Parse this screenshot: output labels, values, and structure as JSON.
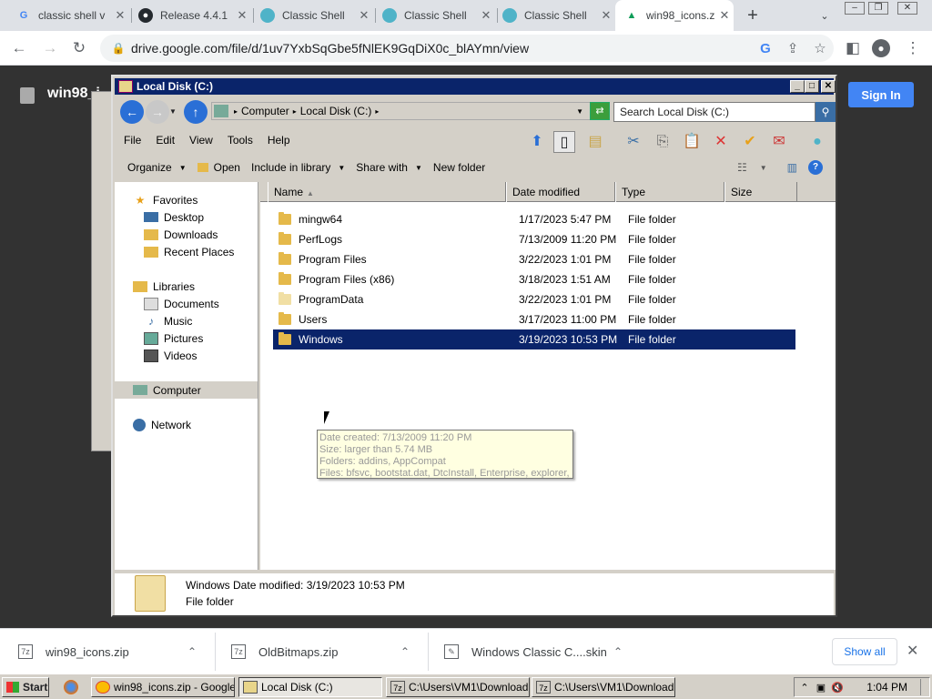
{
  "browser": {
    "tabs": [
      {
        "label": "classic shell v",
        "icon": "google-icon"
      },
      {
        "label": "Release 4.4.1",
        "icon": "github-icon"
      },
      {
        "label": "Classic Shell",
        "icon": "classic-shell-icon"
      },
      {
        "label": "Classic Shell",
        "icon": "classic-shell-icon"
      },
      {
        "label": "Classic Shell",
        "icon": "classic-shell-icon"
      },
      {
        "label": "win98_icons.z",
        "icon": "google-drive-icon",
        "active": true
      }
    ],
    "new_tab": "+",
    "url": "drive.google.com/file/d/1uv7YxbSqGbe5fNlEK9GqDiX0c_blAYmn/view"
  },
  "drive": {
    "file_title": "win98_i",
    "sign_in": "Sign In"
  },
  "explorer": {
    "title": "Local Disk (C:)",
    "address": [
      "Computer",
      "Local Disk (C:)"
    ],
    "search_placeholder": "Search Local Disk (C:)",
    "menu": [
      "File",
      "Edit",
      "View",
      "Tools",
      "Help"
    ],
    "commands": {
      "organize": "Organize",
      "open": "Open",
      "include": "Include in library",
      "share": "Share with",
      "new_folder": "New folder"
    },
    "nav": {
      "favorites": "Favorites",
      "desktop": "Desktop",
      "downloads": "Downloads",
      "recent": "Recent Places",
      "libraries": "Libraries",
      "documents": "Documents",
      "music": "Music",
      "pictures": "Pictures",
      "videos": "Videos",
      "computer": "Computer",
      "network": "Network"
    },
    "columns": {
      "name": "Name",
      "date": "Date modified",
      "type": "Type",
      "size": "Size"
    },
    "files": [
      {
        "name": "mingw64",
        "date": "1/17/2023 5:47 PM",
        "type": "File folder"
      },
      {
        "name": "PerfLogs",
        "date": "7/13/2009 11:20 PM",
        "type": "File folder"
      },
      {
        "name": "Program Files",
        "date": "3/22/2023 1:01 PM",
        "type": "File folder"
      },
      {
        "name": "Program Files (x86)",
        "date": "3/18/2023 1:51 AM",
        "type": "File folder"
      },
      {
        "name": "ProgramData",
        "date": "3/22/2023 1:01 PM",
        "type": "File folder"
      },
      {
        "name": "Users",
        "date": "3/17/2023 11:00 PM",
        "type": "File folder"
      },
      {
        "name": "Windows",
        "date": "3/19/2023 10:53 PM",
        "type": "File folder"
      }
    ],
    "tooltip": [
      "Date created: 7/13/2009 11:20 PM",
      "Size: larger than 5.74 MB",
      "Folders: addins, AppCompat",
      "Files: bfsvc, bootstat.dat, DtcInstall, Enterprise, explorer, ..."
    ],
    "details": {
      "line1": "Windows  Date modified: 3/19/2023 10:53 PM",
      "line2": "File folder"
    }
  },
  "downloads": {
    "items": [
      "win98_icons.zip",
      "OldBitmaps.zip",
      "Windows Classic C....skin"
    ],
    "show_all": "Show all"
  },
  "taskbar": {
    "start": "Start",
    "buttons": [
      "win98_icons.zip - Google ...",
      "Local Disk (C:)",
      "C:\\Users\\VM1\\Download...",
      "C:\\Users\\VM1\\Download..."
    ],
    "clock": "1:04 PM"
  },
  "colors": {
    "selection": "#0a246a",
    "titlebar": "#0a246a",
    "signin": "#4285f4"
  }
}
